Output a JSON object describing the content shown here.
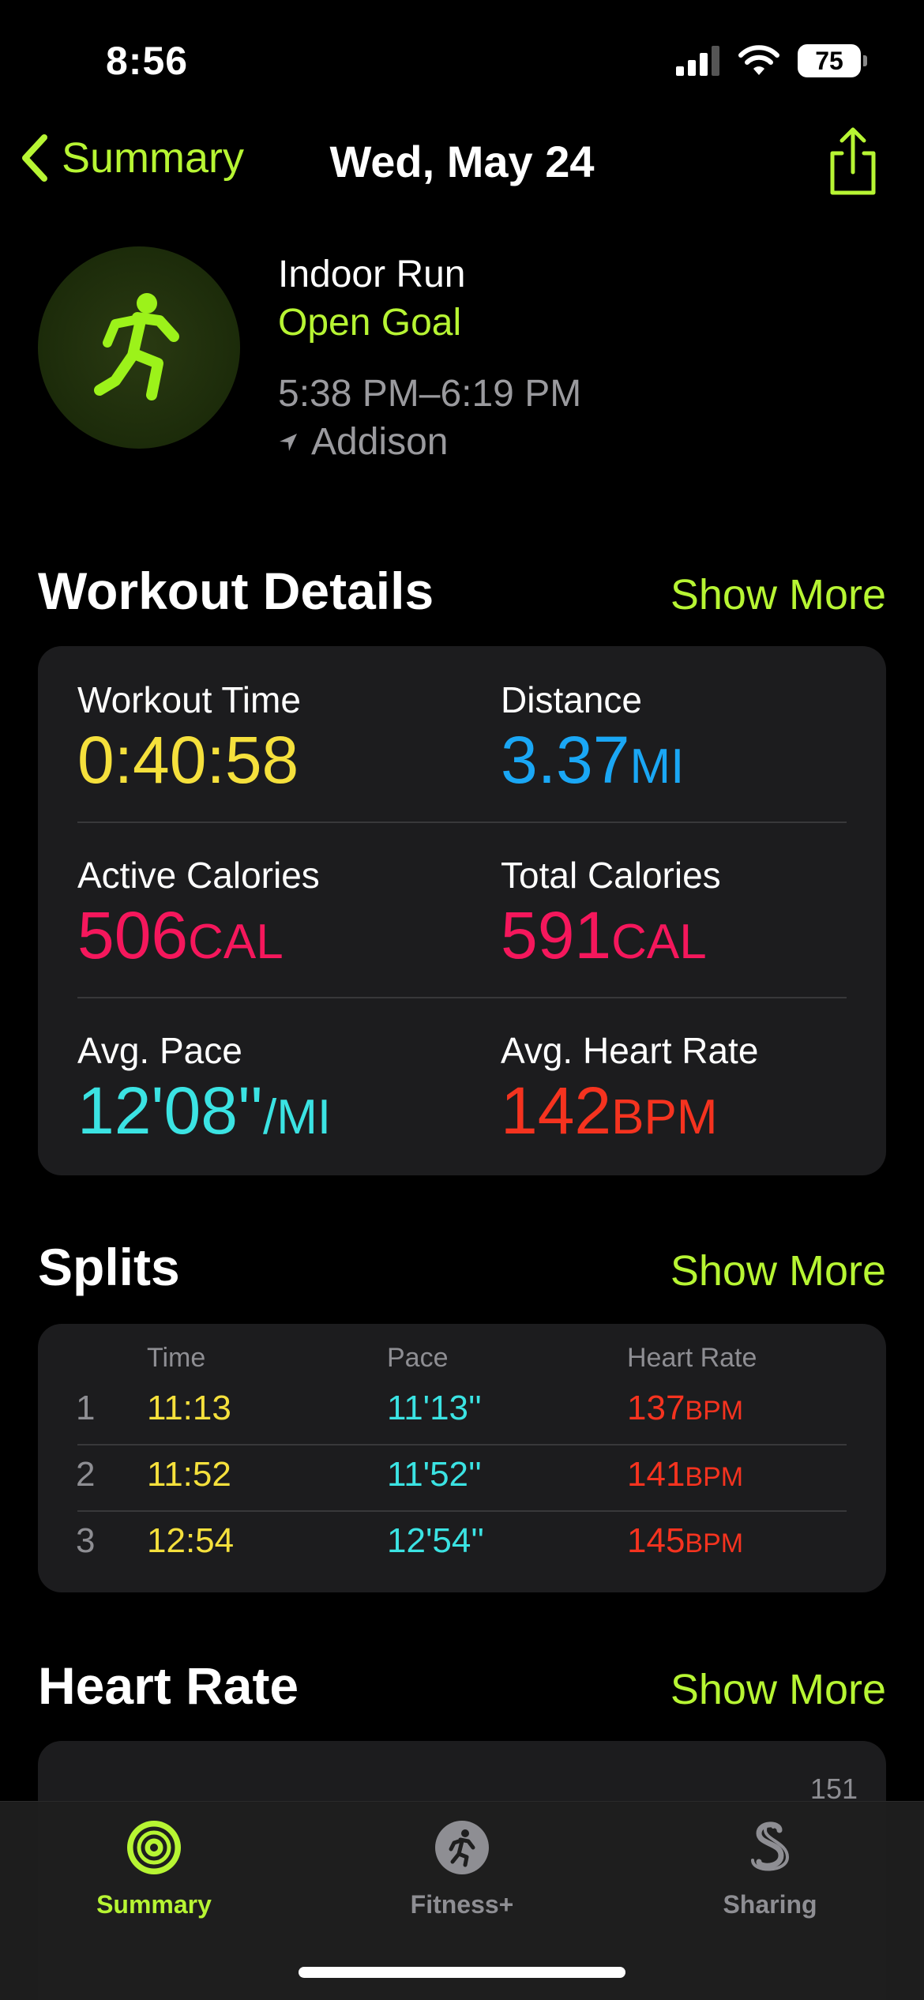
{
  "status_bar": {
    "time": "8:56",
    "battery": "75"
  },
  "nav": {
    "back_label": "Summary",
    "title": "Wed, May 24"
  },
  "workout": {
    "name": "Indoor Run",
    "goal": "Open Goal",
    "time_range": "5:38 PM–6:19 PM",
    "location": "Addison"
  },
  "details": {
    "title": "Workout Details",
    "show_more": "Show More",
    "workout_time": {
      "label": "Workout Time",
      "value": "0:40:58"
    },
    "distance": {
      "label": "Distance",
      "value": "3.37",
      "unit": "MI"
    },
    "active_calories": {
      "label": "Active Calories",
      "value": "506",
      "unit": "CAL"
    },
    "total_calories": {
      "label": "Total Calories",
      "value": "591",
      "unit": "CAL"
    },
    "avg_pace": {
      "label": "Avg. Pace",
      "value": "12'08''",
      "unit": "/MI"
    },
    "avg_heart_rate": {
      "label": "Avg. Heart Rate",
      "value": "142",
      "unit": "BPM"
    }
  },
  "splits": {
    "title": "Splits",
    "show_more": "Show More",
    "headers": {
      "time": "Time",
      "pace": "Pace",
      "heart_rate": "Heart Rate"
    },
    "rows": [
      {
        "num": "1",
        "time": "11:13",
        "pace": "11'13''",
        "hr": "137",
        "hr_unit": "BPM"
      },
      {
        "num": "2",
        "time": "11:52",
        "pace": "11'52''",
        "hr": "141",
        "hr_unit": "BPM"
      },
      {
        "num": "3",
        "time": "12:54",
        "pace": "12'54''",
        "hr": "145",
        "hr_unit": "BPM"
      }
    ]
  },
  "heart_rate": {
    "title": "Heart Rate",
    "show_more": "Show More",
    "max_label": "151"
  },
  "tabs": [
    {
      "label": "Summary",
      "icon": "activity-rings-icon",
      "active": true
    },
    {
      "label": "Fitness+",
      "icon": "fitness-plus-icon",
      "active": false
    },
    {
      "label": "Sharing",
      "icon": "sharing-icon",
      "active": false
    }
  ],
  "colors": {
    "accent": "#b7f533",
    "yellow": "#f5e03c",
    "blue": "#1aa7f5",
    "pink": "#f5175c",
    "cyan": "#3be3e3",
    "red": "#f5331f"
  }
}
